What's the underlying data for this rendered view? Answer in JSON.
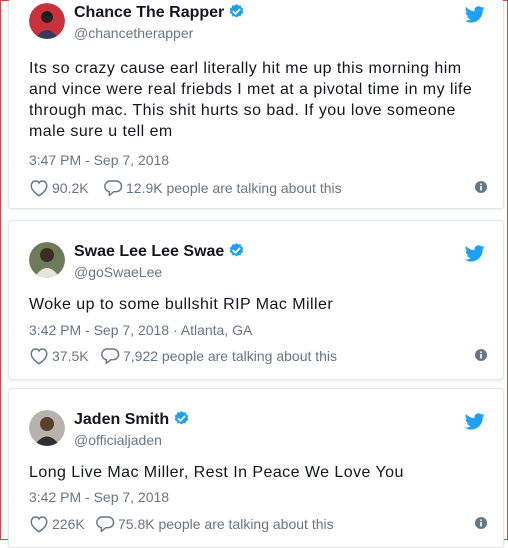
{
  "tweets": [
    {
      "name": "Chance The Rapper",
      "handle": "@chancetherapper",
      "text": "Its so crazy cause earl literally hit me up this morning him and vince were real friebds I met at a pivotal time in my life through mac. This shit hurts so bad. If you love someone male sure u tell em",
      "meta": "3:47 PM - Sep 7, 2018",
      "likes": "90.2K",
      "talking": "12.9K people are talking about this"
    },
    {
      "name": "Swae Lee Lee Swae",
      "handle": "@goSwaeLee",
      "text": "Woke up to some bullshit RIP Mac Miller",
      "meta": "3:42 PM - Sep 7, 2018 · Atlanta, GA",
      "likes": "37.5K",
      "talking": "7,922 people are talking about this"
    },
    {
      "name": "Jaden Smith",
      "handle": "@officialjaden",
      "text": "Long Live Mac Miller, Rest In Peace We Love You",
      "meta": "3:42 PM - Sep 7, 2018",
      "likes": "226K",
      "talking": "75.8K people are talking about this"
    }
  ],
  "colors": {
    "twitter_blue": "#1da1f2",
    "verified_blue": "#1da1f2",
    "muted_text": "#657786",
    "border": "#e1e8ed"
  },
  "icons": {
    "brand": "twitter-bird-icon",
    "verified": "verified-badge-icon",
    "like": "heart-icon",
    "reply": "speech-bubble-icon",
    "info": "info-icon"
  }
}
